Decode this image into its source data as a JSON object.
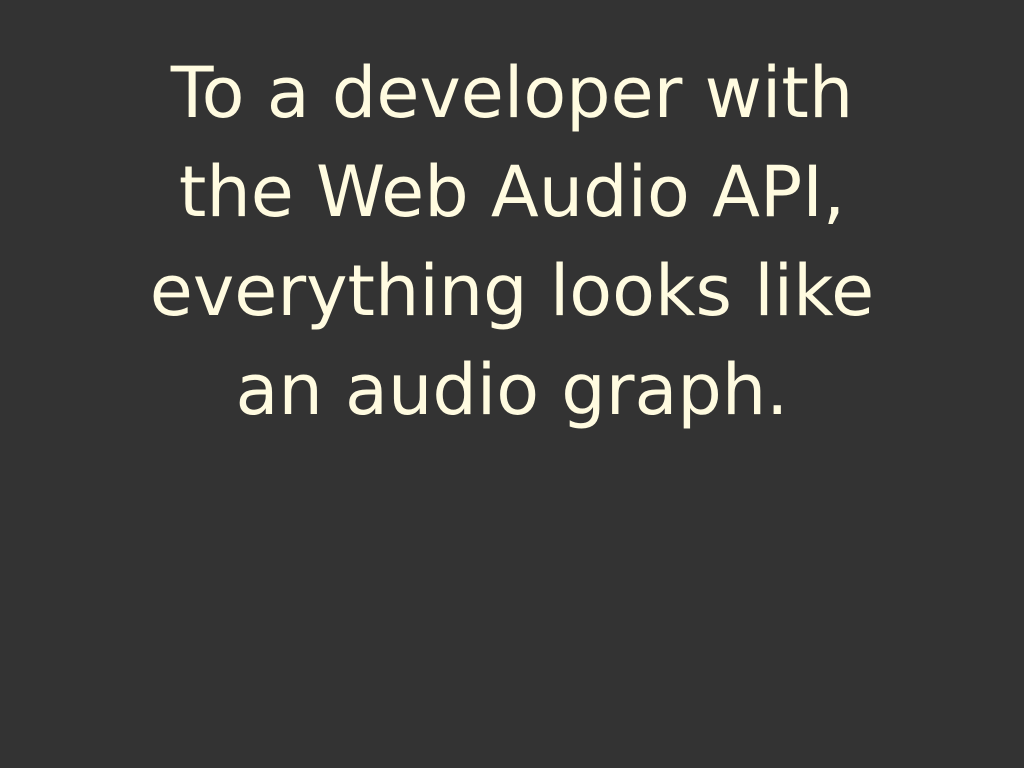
{
  "slide": {
    "lines": [
      "To a developer with",
      "the Web Audio API,",
      "everything looks like",
      "an audio graph."
    ]
  },
  "colors": {
    "background": "#333333",
    "text": "#fffbe0"
  }
}
